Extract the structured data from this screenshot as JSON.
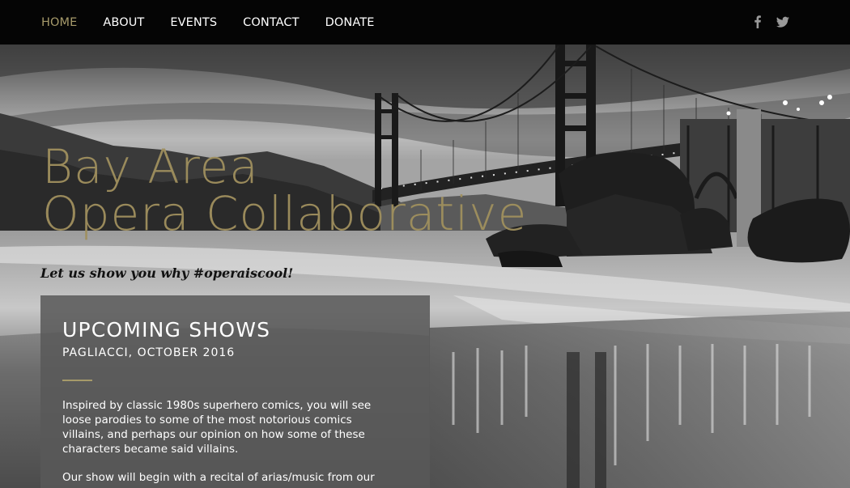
{
  "nav": {
    "items": [
      {
        "label": "HOME",
        "active": true
      },
      {
        "label": "ABOUT",
        "active": false
      },
      {
        "label": "EVENTS",
        "active": false
      },
      {
        "label": "CONTACT",
        "active": false
      },
      {
        "label": "DONATE",
        "active": false
      }
    ],
    "social": [
      "facebook-icon",
      "twitter-icon"
    ]
  },
  "hero": {
    "title_line1": "Bay Area",
    "title_line2": "Opera Collaborative",
    "tagline": "Let us show you why #operaiscool!",
    "background": "golden-gate-bridge-black-and-white-photo"
  },
  "shows": {
    "heading": "UPCOMING SHOWS",
    "subheading": "PAGLIACCI, OCTOBER 2016",
    "paragraph1": "Inspired by classic 1980s superhero comics, you will see loose parodies to some of the most notorious comics villains, and perhaps our opinion on how some of these characters became said villains.",
    "paragraph2": "Our show will begin with a recital of arias/music from our"
  },
  "colors": {
    "accent": "#a69a6a",
    "title": "#a0905e",
    "nav_bg": "#050505",
    "panel_bg": "#585858"
  }
}
